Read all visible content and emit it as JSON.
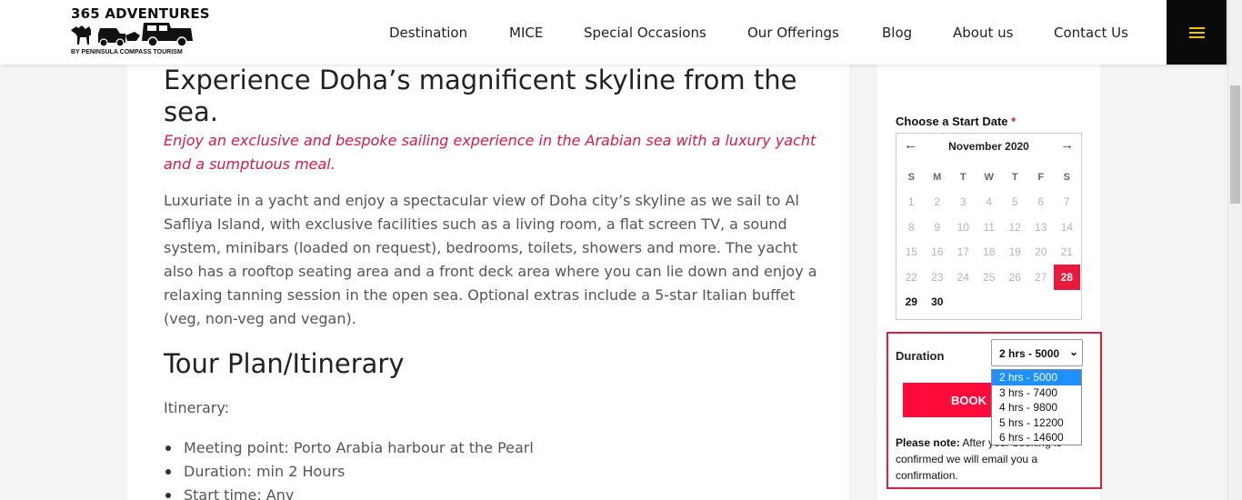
{
  "header": {
    "logo_title": "365 ADVENTURES",
    "logo_subtitle": "BY PENINSULA COMPASS TOURISM",
    "nav": [
      "Destination",
      "MICE",
      "Special Occasions",
      "Our Offerings",
      "Blog",
      "About us",
      "Contact Us"
    ],
    "menu_icon": "hamburger-icon",
    "menu_color": "#f5c400"
  },
  "main": {
    "title": "Experience Doha’s magnificent skyline from the sea.",
    "tagline": "Enjoy an exclusive and bespoke sailing experience in the Arabian sea with a luxury yacht and a sumptuous meal.",
    "description": "Luxuriate in a yacht and enjoy a spectacular view of Doha city’s skyline as we sail to Al Safliya Island, with exclusive facilities such as a living room, a flat screen TV, a sound system, minibars (loaded on request), bedrooms, toilets, showers and more. The yacht also has a rooftop seating area and a front deck area where you can lie down and enjoy a relaxing tanning session in the open sea. Optional extras include a 5-star Italian buffet (veg, non-veg and vegan).",
    "section_title": "Tour Plan/Itinerary",
    "itinerary_label": "Itinerary:",
    "itinerary": [
      "Meeting point: Porto Arabia harbour at the Pearl",
      "Duration: min 2 Hours",
      "Start time: Any"
    ],
    "accent_color": "#d81b45"
  },
  "booking": {
    "start_label": "Choose a Start Date",
    "required_mark": "*",
    "calendar": {
      "month": "November 2020",
      "prev_icon": "arrow-left-icon",
      "next_icon": "arrow-right-icon",
      "weekdays": [
        "S",
        "M",
        "T",
        "W",
        "T",
        "F",
        "S"
      ],
      "days": [
        "1",
        "2",
        "3",
        "4",
        "5",
        "6",
        "7",
        "8",
        "9",
        "10",
        "11",
        "12",
        "13",
        "14",
        "15",
        "16",
        "17",
        "18",
        "19",
        "20",
        "21",
        "22",
        "23",
        "24",
        "25",
        "26",
        "27",
        "28",
        "29",
        "30"
      ],
      "selected": "28",
      "available": [
        "28",
        "29",
        "30"
      ]
    },
    "duration_label": "Duration",
    "duration_value": "2 hrs - 5000",
    "duration_options": [
      "2 hrs - 5000",
      "3 hrs - 7400",
      "4 hrs - 9800",
      "5 hrs - 12200",
      "6 hrs - 14600"
    ],
    "book_label": "BOOK",
    "note_bold": "Please note:",
    "note_text": "After your booking is confirmed we will email you a confirmation.",
    "button_color": "#ff0a3a",
    "highlight_color": "#d6233f"
  }
}
